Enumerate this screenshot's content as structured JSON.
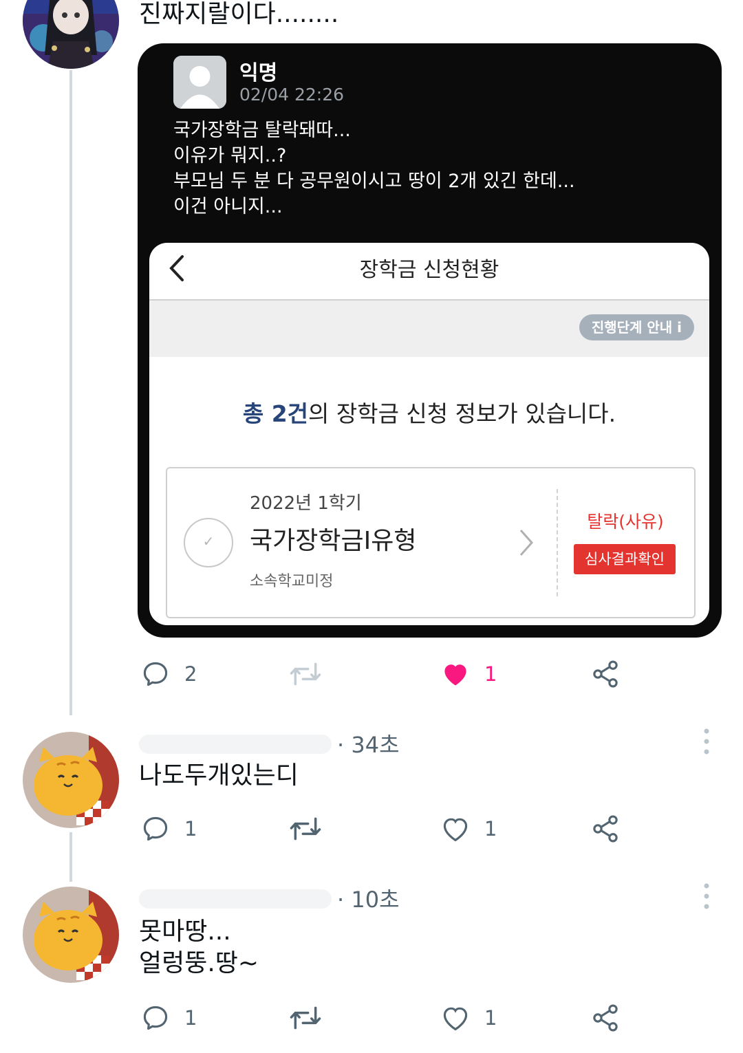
{
  "tweet": {
    "text": "진짜지랄이다........",
    "embed": {
      "author": "익명",
      "date": "02/04 22:26",
      "body": "국가장학금 탈락돼따...\n이유가 뭐지..?\n부모님 두 분 다 공무원이시고 땅이 2개 있긴 한데...\n이건 아니지...",
      "app": {
        "title": "장학금 신청현황",
        "stage_guide": "진행단계 안내 i",
        "summary_highlight": "총 2건",
        "summary_rest": "의 장학금 신청 정보가 있습니다.",
        "item": {
          "semester": "2022년 1학기",
          "name": "국가장학금I유형",
          "school": "소속학교미정",
          "status": "탈락(사유)",
          "button": "심사결과확인"
        }
      }
    },
    "actions": {
      "replies": "2",
      "likes": "1",
      "liked": true
    }
  },
  "replies": [
    {
      "time": "· 34초",
      "text": "나도두개있는디",
      "actions": {
        "replies": "1",
        "likes": "1"
      }
    },
    {
      "time": "· 10초",
      "text": "못마땅...\n얼렁뚱.땅~",
      "actions": {
        "replies": "1",
        "likes": "1"
      }
    }
  ],
  "colors": {
    "like": "#f91880",
    "icon": "#536471",
    "reject": "#e3342f"
  }
}
